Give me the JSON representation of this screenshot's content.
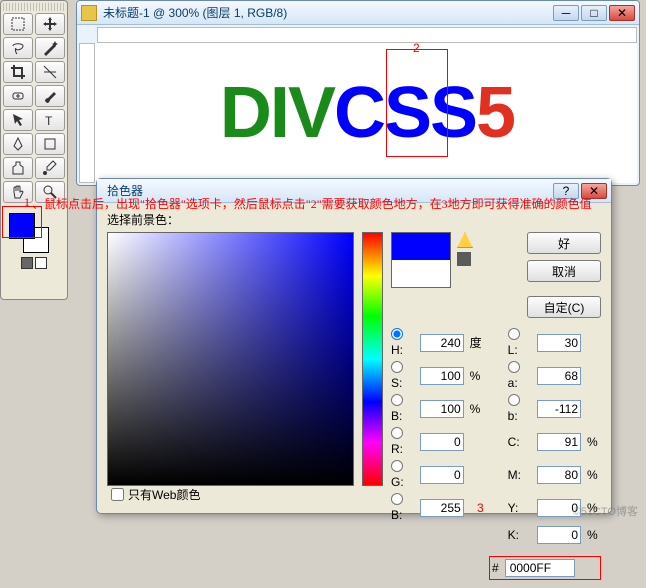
{
  "doc": {
    "title": "未标题-1 @ 300% (图层 1, RGB/8)",
    "text_d": "D",
    "text_i": "I",
    "text_v": "V",
    "text_c": "C",
    "text_s1": "S",
    "text_s2": "S",
    "text_5": "5",
    "marker2": "2"
  },
  "annotation": {
    "marker1": "1",
    "text": "、鼠标点击后，出现\"拾色器\"选项卡，然后鼠标点击\"2\"需要获取颜色地方，在3地方即可获得准确的颜色值"
  },
  "picker": {
    "title": "拾色器",
    "select_fg": "选择前景色：",
    "ok": "好",
    "cancel": "取消",
    "custom": "自定(C)",
    "H": {
      "label": "H:",
      "value": "240",
      "unit": "度"
    },
    "S": {
      "label": "S:",
      "value": "100",
      "unit": "%"
    },
    "Bhsb": {
      "label": "B:",
      "value": "100",
      "unit": "%"
    },
    "R": {
      "label": "R:",
      "value": "0"
    },
    "G": {
      "label": "G:",
      "value": "0"
    },
    "Brgb": {
      "label": "B:",
      "value": "255"
    },
    "L": {
      "label": "L:",
      "value": "30"
    },
    "a": {
      "label": "a:",
      "value": "68"
    },
    "b": {
      "label": "b:",
      "value": "-112"
    },
    "C": {
      "label": "C:",
      "value": "91",
      "unit": "%"
    },
    "M": {
      "label": "M:",
      "value": "80",
      "unit": "%"
    },
    "Y": {
      "label": "Y:",
      "value": "0",
      "unit": "%"
    },
    "K": {
      "label": "K:",
      "value": "0",
      "unit": "%"
    },
    "hash": "#",
    "hex": "0000FF",
    "webonly": "只有Web颜色",
    "marker3": "3"
  },
  "watermark": "©51CTO博客"
}
